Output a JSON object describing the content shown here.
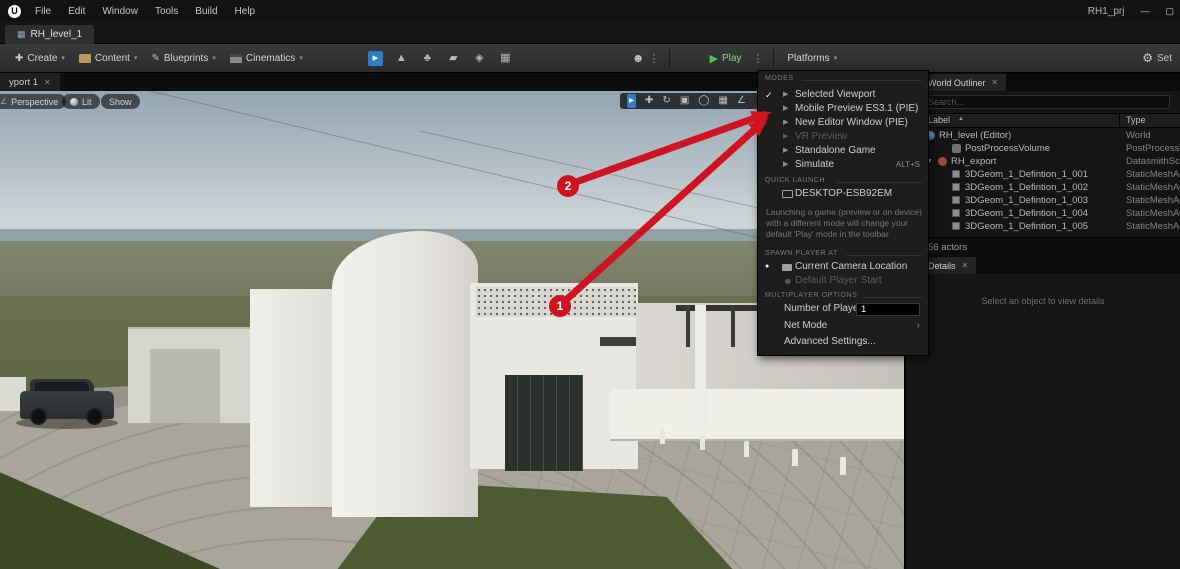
{
  "window": {
    "project_name": "RH1_prj"
  },
  "menu_bar": {
    "items": [
      {
        "label": "File"
      },
      {
        "label": "Edit"
      },
      {
        "label": "Window"
      },
      {
        "label": "Tools"
      },
      {
        "label": "Build"
      },
      {
        "label": "Help"
      }
    ]
  },
  "level_tab": {
    "label": "RH_level_1"
  },
  "toolbar": {
    "create_label": "Create",
    "content_label": "Content",
    "blueprints_label": "Blueprints",
    "cinematics_label": "Cinematics",
    "play_label": "Play",
    "platforms_label": "Platforms",
    "settings_label": "Set"
  },
  "viewport": {
    "tab_label": "yport 1",
    "perspective_label": "Perspective",
    "lit_label": "Lit",
    "show_label": "Show"
  },
  "play_menu": {
    "modes_header": "MODES",
    "items": [
      {
        "label": "Selected Viewport"
      },
      {
        "label": "Mobile Preview ES3.1 (PIE)"
      },
      {
        "label": "New Editor Window (PIE)"
      },
      {
        "label": "VR Preview"
      },
      {
        "label": "Standalone Game"
      },
      {
        "label": "Simulate",
        "shortcut": "ALT+S"
      }
    ],
    "quick_launch_header": "QUICK LAUNCH",
    "quick_launch_device": "DESKTOP-ESB92EM",
    "info_text": "Launching a game (preview or on device) with a different mode will change your default 'Play' mode in the toolbar",
    "spawn_header": "SPAWN PLAYER AT",
    "spawn_items": [
      {
        "label": "Current Camera Location"
      },
      {
        "label": "Default Player Start"
      }
    ],
    "multiplayer_header": "MULTIPLAYER OPTIONS",
    "number_of_players_label": "Number of Players",
    "number_of_players_value": "1",
    "net_mode_label": "Net Mode",
    "advanced_settings_label": "Advanced Settings..."
  },
  "world_outliner": {
    "tab_label": "World Outliner",
    "search_placeholder": "Search...",
    "columns": {
      "label": "Label",
      "type": "Type"
    },
    "rows": [
      {
        "label": "RH_level (Editor)",
        "type": "World"
      },
      {
        "label": "PostProcessVolume",
        "type": "PostProcessVo"
      },
      {
        "label": "RH_export",
        "type": "DatasmithSce"
      },
      {
        "label": "3DGeom_1_Defintion_1_001",
        "type": "StaticMeshAc"
      },
      {
        "label": "3DGeom_1_Defintion_1_002",
        "type": "StaticMeshAc"
      },
      {
        "label": "3DGeom_1_Defintion_1_003",
        "type": "StaticMeshAc"
      },
      {
        "label": "3DGeom_1_Defintion_1_004",
        "type": "StaticMeshAc"
      },
      {
        "label": "3DGeom_1_Defintion_1_005",
        "type": "StaticMeshAc"
      }
    ],
    "footer": "56 actors"
  },
  "details_panel": {
    "tab_label": "Details",
    "empty_text": "Select an object to view details"
  },
  "annotations": {
    "circles": [
      {
        "label": "2"
      },
      {
        "label": "1"
      }
    ]
  },
  "icons": {
    "ue_logo": "U",
    "play": "▶",
    "caret": "▾",
    "kebab": "⋮",
    "check": "✓",
    "close": "✕",
    "expand": "▼",
    "submenu": "›",
    "radio": "●",
    "gear": "⚙",
    "sort": "▲",
    "minimize": "—",
    "restore": "▢",
    "select": "▸",
    "move": "✚",
    "rotate": "↻",
    "scale": "▣",
    "globe": "◯",
    "grid": "▦",
    "angle": "∠",
    "mountain": "▲",
    "foliage": "♣",
    "paint": "▰",
    "fracture": "◈",
    "person": "☻",
    "create": "✚",
    "pencil": "✎"
  },
  "colors": {
    "accent_green": "#51c151",
    "annotation_red": "#cf1322",
    "selection_blue": "#2e7cc4"
  }
}
